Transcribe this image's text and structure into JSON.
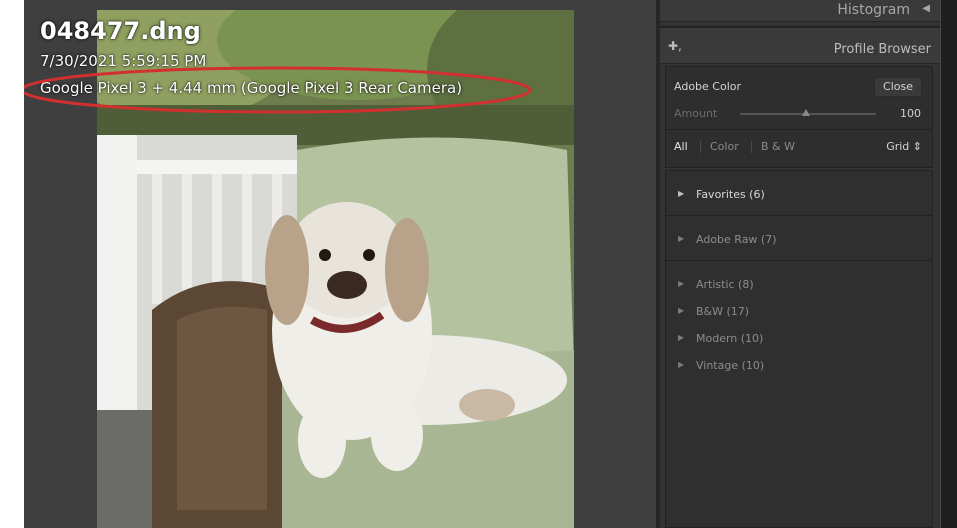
{
  "photo_info": {
    "filename": "048477.dng",
    "datetime": "7/30/2021 5:59:15 PM",
    "camera": "Google Pixel 3 + 4.44 mm (Google Pixel 3 Rear Camera)"
  },
  "panels": {
    "histogram": {
      "title": "Histogram",
      "collapse_icon": "triangle-left-icon"
    },
    "profile_browser": {
      "title": "Profile Browser",
      "add_icon": "plus-icon",
      "current_profile": "Adobe Color",
      "close_label": "Close",
      "amount_label": "Amount",
      "amount_value": "100",
      "filters": [
        "All",
        "Color",
        "B & W"
      ],
      "active_filter": "All",
      "view_mode": "Grid",
      "groups": [
        {
          "label": "Favorites (6)",
          "active": true
        },
        {
          "label": "Adobe Raw (7)",
          "active": false
        },
        {
          "label": "Artistic (8)",
          "active": false
        },
        {
          "label": "B&W (17)",
          "active": false
        },
        {
          "label": "Modern (10)",
          "active": false
        },
        {
          "label": "Vintage (10)",
          "active": false
        }
      ]
    }
  },
  "colors": {
    "annotation": "#d23030",
    "canvas_bg": "#3f3f3f",
    "panel_bg": "#333333"
  }
}
